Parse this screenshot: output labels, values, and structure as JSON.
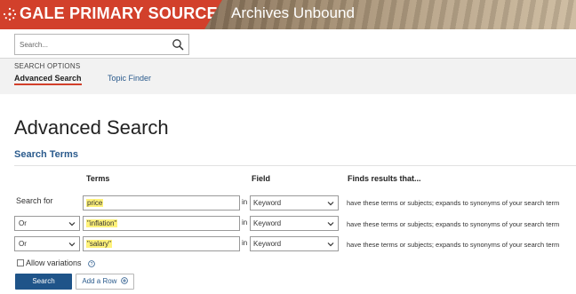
{
  "header": {
    "brand_title": "GALE PRIMARY SOURCES",
    "product_title": "Archives Unbound",
    "brand_color": "#d2402b"
  },
  "search": {
    "placeholder": "Search...",
    "value": ""
  },
  "options": {
    "label": "SEARCH OPTIONS",
    "tabs": [
      {
        "label": "Advanced Search",
        "active": true
      },
      {
        "label": "Topic Finder",
        "active": false
      }
    ]
  },
  "main": {
    "page_title": "Advanced Search",
    "section_title": "Search Terms",
    "columns": {
      "terms": "Terms",
      "field": "Field",
      "finds": "Finds results that..."
    },
    "rows": [
      {
        "operator_label": "Search for",
        "term": "price",
        "in": "in",
        "field": "Keyword",
        "finds": "have these terms or subjects; expands to synonyms of your search term"
      },
      {
        "operator": "Or",
        "term": "\"inflation\"",
        "in": "in",
        "field": "Keyword",
        "finds": "have these terms or subjects; expands to synonyms of your search term"
      },
      {
        "operator": "Or",
        "term": "\"salary\"",
        "in": "in",
        "field": "Keyword",
        "finds": "have these terms or subjects; expands to synonyms of your search term"
      }
    ],
    "allow_variations": {
      "label": "Allow variations",
      "checked": false
    },
    "buttons": {
      "search": "Search",
      "add_row": "Add a Row"
    }
  }
}
